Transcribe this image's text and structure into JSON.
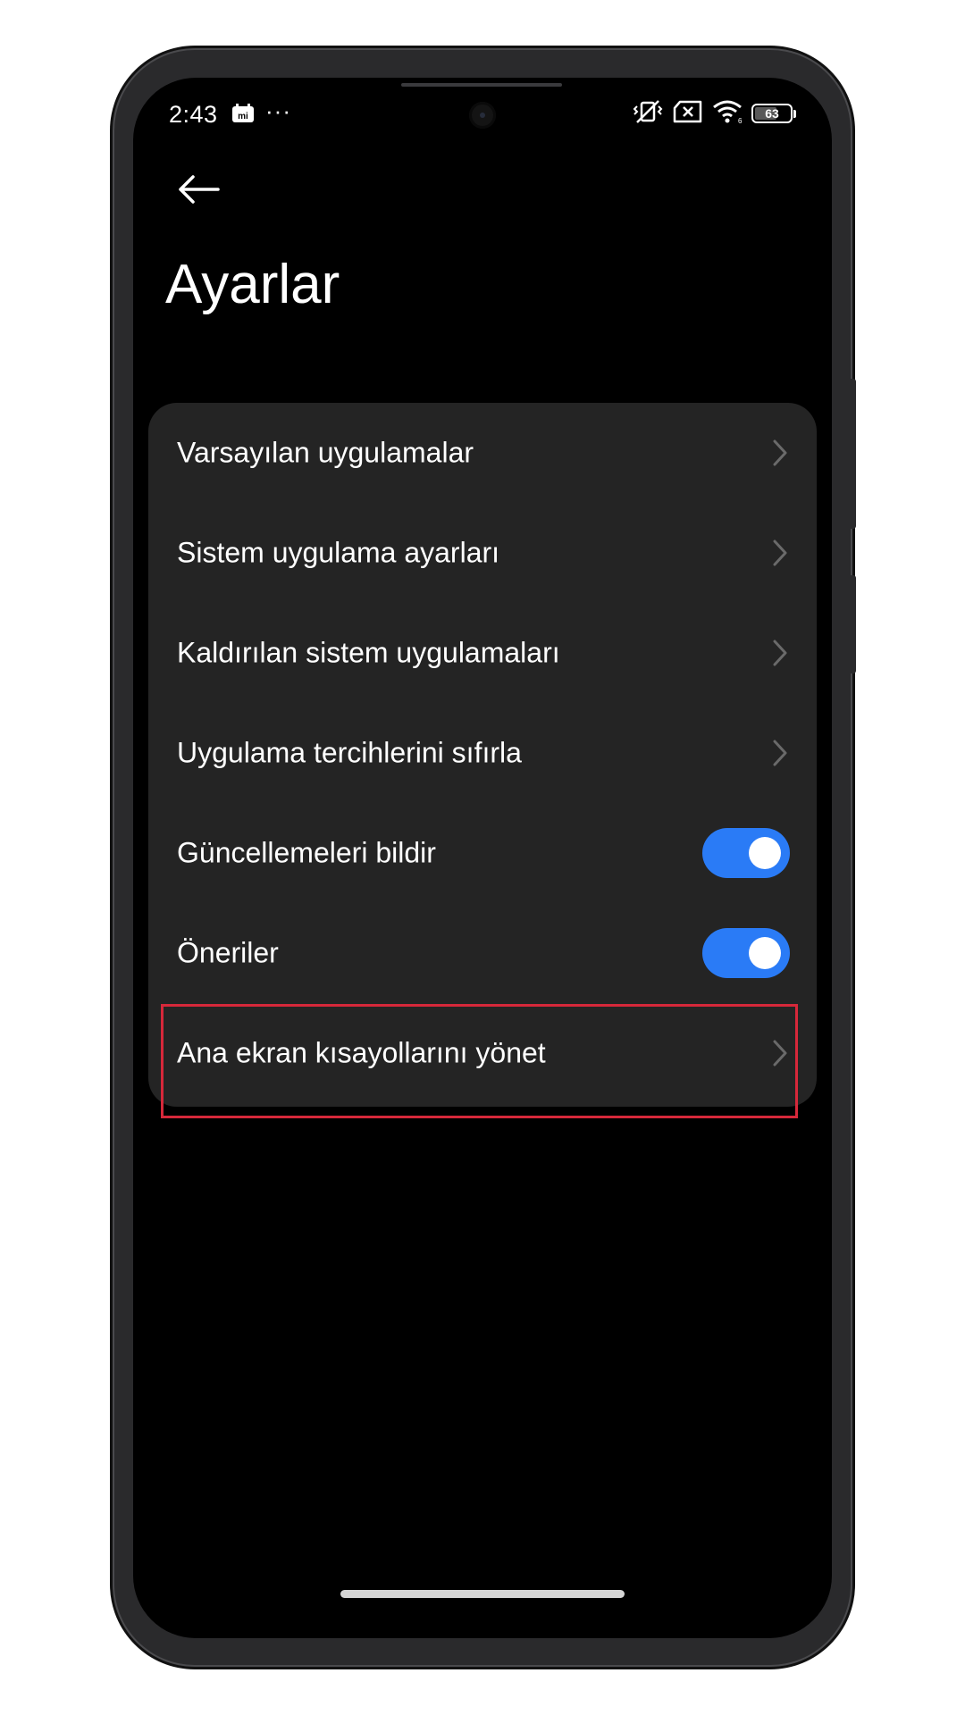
{
  "status_bar": {
    "time": "2:43",
    "more": "···",
    "battery_level": "63"
  },
  "header": {
    "title": "Ayarlar"
  },
  "settings": {
    "items": [
      {
        "label": "Varsayılan uygulamalar",
        "control": "chevron"
      },
      {
        "label": "Sistem uygulama ayarları",
        "control": "chevron"
      },
      {
        "label": "Kaldırılan sistem uygulamaları",
        "control": "chevron"
      },
      {
        "label": "Uygulama tercihlerini sıfırla",
        "control": "chevron"
      },
      {
        "label": "Güncellemeleri bildir",
        "control": "toggle",
        "enabled": true
      },
      {
        "label": "Öneriler",
        "control": "toggle",
        "enabled": true
      },
      {
        "label": "Ana ekran kısayollarını yönet",
        "control": "chevron",
        "highlighted": true
      }
    ]
  },
  "colors": {
    "background": "#000000",
    "card": "#242424",
    "toggle_on": "#2a7bf6",
    "highlight": "#d6283a",
    "text": "#ffffff",
    "chevron": "#6a6a6a"
  }
}
